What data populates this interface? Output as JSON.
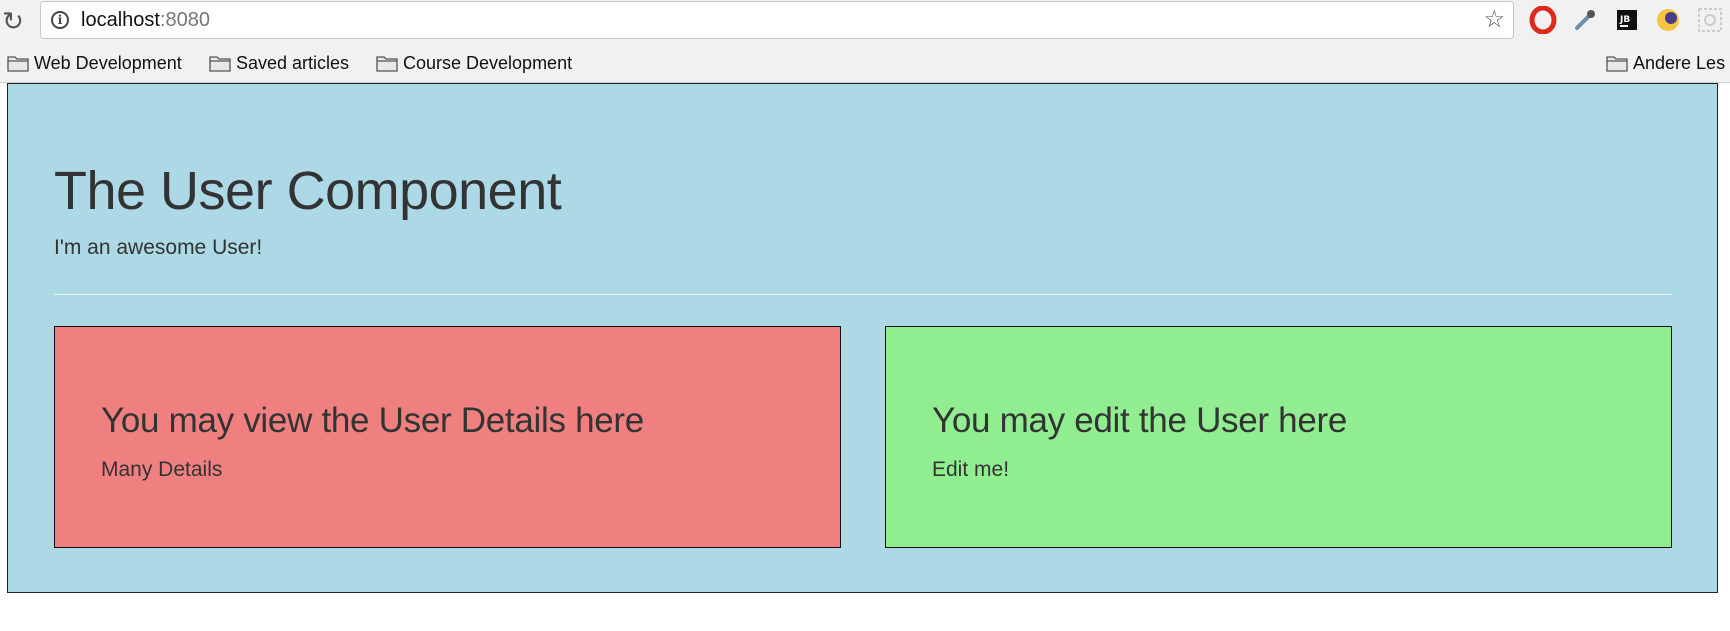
{
  "browser": {
    "url_host": "localhost",
    "url_port": ":8080",
    "extensions": [
      "opera-icon",
      "eyedropper-icon",
      "jetbrains-icon",
      "moon-icon",
      "gear-icon"
    ]
  },
  "bookmarks": [
    {
      "label": "Web Development",
      "icon": "folder-icon"
    },
    {
      "label": "Saved articles",
      "icon": "folder-icon"
    },
    {
      "label": "Course Development",
      "icon": "folder-icon"
    },
    {
      "label": "Andere Les",
      "icon": "folder-icon"
    }
  ],
  "page": {
    "title": "The User Component",
    "subtitle": "I'm an awesome User!",
    "background": "#add8e6",
    "details_card": {
      "heading": "You may view the User Details here",
      "text": "Many Details",
      "color": "#f08080"
    },
    "edit_card": {
      "heading": "You may edit the User here",
      "text": "Edit me!",
      "color": "#90ee90"
    }
  }
}
